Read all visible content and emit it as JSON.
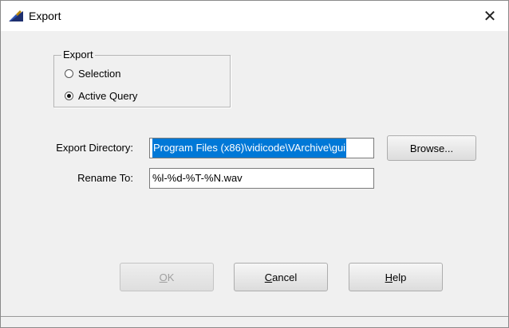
{
  "window": {
    "title": "Export",
    "close_glyph": "✕"
  },
  "export_group": {
    "legend": "Export",
    "options": [
      {
        "label": "Selection",
        "checked": false
      },
      {
        "label": "Active Query",
        "checked": true
      }
    ]
  },
  "form": {
    "export_directory_label": "Export Directory:",
    "export_directory_value": "Program Files (x86)\\vidicode\\VArchive\\gui",
    "rename_to_label": "Rename To:",
    "rename_to_value": "%l-%d-%T-%N.wav"
  },
  "buttons": {
    "browse": "Browse...",
    "ok_accel": "O",
    "ok_rest": "K",
    "cancel_accel": "C",
    "cancel_rest": "ancel",
    "help_accel": "H",
    "help_rest": "elp"
  },
  "colors": {
    "selection": "#0078d7",
    "background": "#f0f0f0"
  }
}
